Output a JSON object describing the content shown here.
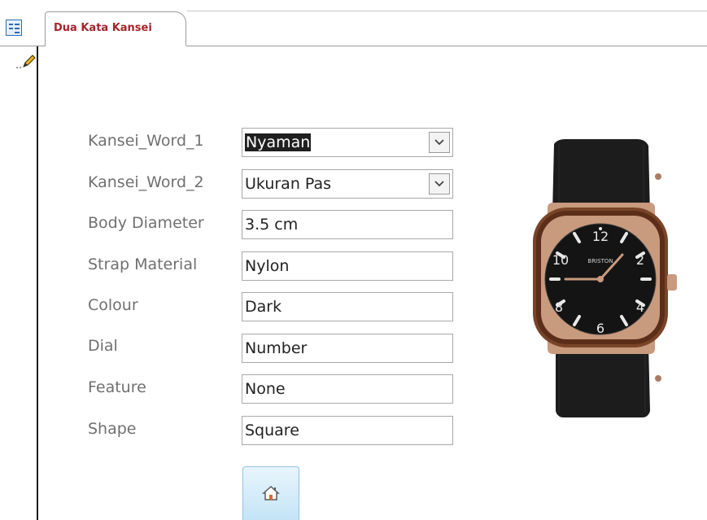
{
  "document_tab": {
    "icon": "form-icon",
    "title": "Dua Kata Kansei"
  },
  "record_selector": {
    "icon": "pencil-edit-icon"
  },
  "form": {
    "fields": [
      {
        "label": "Kansei_Word_1",
        "value": "Nyaman",
        "type": "combo",
        "selected": true
      },
      {
        "label": "Kansei_Word_2",
        "value": "Ukuran Pas",
        "type": "combo",
        "selected": false
      },
      {
        "label": "Body Diameter",
        "value": "3.5 cm",
        "type": "text"
      },
      {
        "label": "Strap Material",
        "value": "Nylon",
        "type": "text"
      },
      {
        "label": "Colour",
        "value": "Dark",
        "type": "text"
      },
      {
        "label": "Dial",
        "value": "Number",
        "type": "text"
      },
      {
        "label": "Feature",
        "value": "None",
        "type": "text"
      },
      {
        "label": "Shape",
        "value": "Square",
        "type": "text"
      }
    ],
    "dropdown_icon": "chevron-down-icon"
  },
  "product_image": {
    "subject": "wristwatch",
    "dial_numerals": [
      "12",
      "2",
      "4",
      "6",
      "8",
      "10"
    ],
    "brand_text": "BRISTON",
    "colors": {
      "strap": "#1c1c1c",
      "case_gold": "#c89a7e",
      "bezel": "#6a3a22",
      "dial": "#141414"
    }
  },
  "home_button": {
    "icon": "home-icon"
  }
}
